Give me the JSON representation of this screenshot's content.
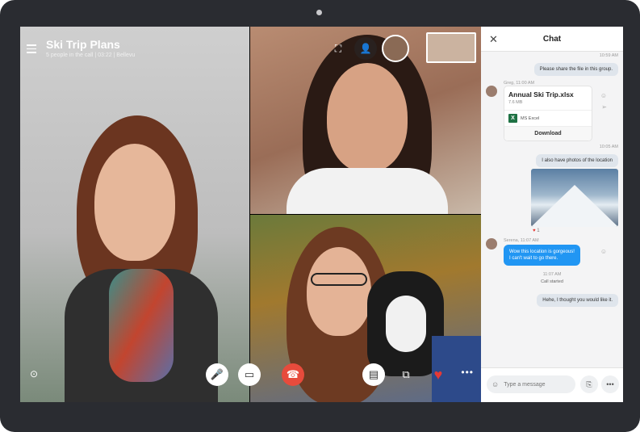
{
  "call": {
    "title": "Ski Trip Plans",
    "subtitle": "5 people in the call | 03:22  |  Bellevu"
  },
  "controls": {
    "mic_icon": "microphone-icon",
    "video_icon": "video-icon",
    "end_icon": "phone-hangup-icon",
    "chat_icon": "chat-icon",
    "share_icon": "screen-share-icon",
    "heart_icon": "heart-icon"
  },
  "chat": {
    "title": "Chat",
    "messages": {
      "m1_time": "10:59 AM",
      "m1_text": "Please share the file in this group.",
      "m2_sender": "Greg, 11:00 AM",
      "file_name": "Annual Ski Trip.xlsx",
      "file_size": "7.6 MB",
      "file_type": "MS Excel",
      "file_download": "Download",
      "m3_time": "10:05 AM",
      "m3_text": "I also have photos of the location",
      "reaction_count": "1",
      "m4_sender": "Serena, 11:07 AM",
      "m4_text_1": "Wow this location is gorgeous!",
      "m4_text_2": "I can't wait to go there.",
      "call_time": "11:07 AM",
      "call_started": "Call started",
      "m5_text": "Hehe, I thought you would like it."
    },
    "composer_placeholder": "Type a message"
  },
  "colors": {
    "accent": "#2196f3",
    "end_call": "#e74b3c",
    "heart": "#e53935"
  }
}
